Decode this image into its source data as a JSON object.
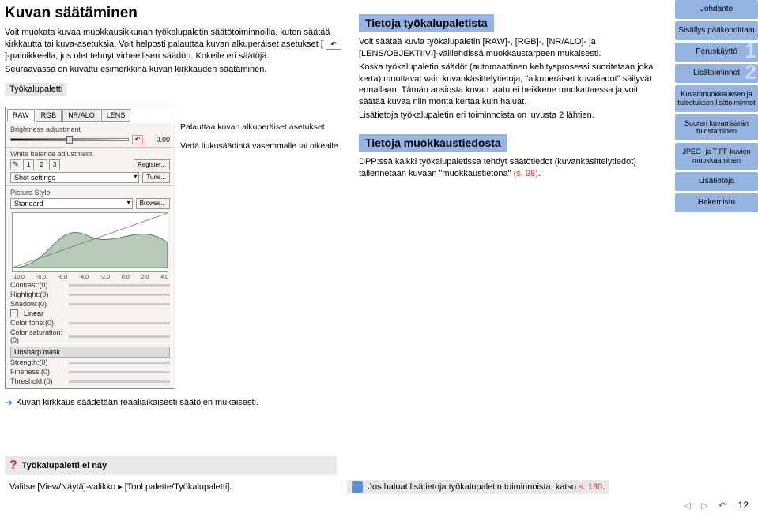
{
  "title": "Kuvan säätäminen",
  "intro": {
    "p1": "Voit muokata kuvaa muokkausikkunan työkalupaletin säätötoiminnoilla, kuten säätää kirkkautta tai kuva-asetuksia. Voit helposti palauttaa kuvan alkuperäiset asetukset [",
    "p1b": "]-painikkeella, jos olet tehnyt virheellisen säädön. Kokeile eri säätöjä.",
    "p2": "Seuraavassa on kuvattu esimerkkinä kuvan kirkkauden säätäminen."
  },
  "palette_label": "Työkalupaletti",
  "callouts": {
    "c1": "Palauttaa kuvan alkuperäiset asetukset",
    "c2": "Vedä liukusäädintä vasemmalle tai oikealle"
  },
  "palette": {
    "tabs": [
      "RAW",
      "RGB",
      "NR/ALO",
      "LENS"
    ],
    "brightness_label": "Brightness adjustment",
    "brightness_val": "0.00",
    "wb_label": "White balance adjustment",
    "wb_btns": [
      "1",
      "2",
      "3"
    ],
    "register": "Register...",
    "shot": "Shot settings",
    "tune": "Tune...",
    "ps_label": "Picture Style",
    "ps_val": "Standard",
    "browse": "Browse...",
    "scale": [
      "-10.0",
      "-8.0",
      "-6.0",
      "-4.0",
      "-2.0",
      "0.0",
      "2.0",
      "4.0"
    ],
    "contrast": "Contrast:(0)",
    "highlight": "Highlight:(0)",
    "shadow": "Shadow:(0)",
    "linear": "Linear",
    "colortone": "Color tone:(0)",
    "colorsat": "Color saturation:(0)",
    "unsharp": "Unsharp mask",
    "strength": "Strength:(0)",
    "fineness": "Fineness:(0)",
    "threshold": "Threshold:(0)"
  },
  "right": {
    "h1": "Tietoja työkalupaletista",
    "p1": "Voit säätää kuvia työkalupaletin [RAW]-, [RGB]-, [NR/ALO]- ja [LENS/OBJEKTIIVI]-välilehdissä muokkaustarpeen mukaisesti.",
    "p2": "Koska työkalupaletin säädöt (automaattinen kehitysprosessi suoritetaan joka kerta) muuttavat vain kuvankäsittelytietoja, \"alkuperäiset kuvatiedot\" säilyvät ennallaan. Tämän ansiosta kuvan laatu ei heikkene muokattaessa ja voit säätää kuvaa niin monta kertaa kuin haluat.",
    "p3": "Lisätietoja työkalupaletin eri toiminnoista on luvusta 2 lähtien.",
    "h2": "Tietoja muokkaustiedosta",
    "p4a": "DPP:ssä kaikki työkalupaletissa tehdyt säätötiedot (kuvankäsittelytiedot) tallennetaan kuvaan \"muokkaustietona\" ",
    "p4link": "(s. 98)",
    "p4b": "."
  },
  "note": "Kuvan kirkkaus säädetään reaaliaikaisesti säätöjen mukaisesti.",
  "faq": {
    "title": "Työkalupaletti ei näy",
    "body": "Valitse [View/Näytä]-valikko ▸ [Tool palette/Työkalupaletti]."
  },
  "hint_a": "Jos haluat lisätietoja työkalupaletin toiminnoista, katso ",
  "hint_link": "s. 130",
  "hint_b": ".",
  "sidebar": {
    "items": [
      {
        "label": "Johdanto"
      },
      {
        "label": "Sisällys pääkohdittain"
      },
      {
        "label": "Peruskäyttö",
        "num": "1"
      },
      {
        "label": "Lisätoiminnot",
        "num": "2"
      },
      {
        "label": "Kuvanmuokkauksen ja tulostuksen lisätoiminnot"
      },
      {
        "label": "Suuren kuvamäärän tulostaminen"
      },
      {
        "label": "JPEG- ja TIFF-kuvien muokkaaminen"
      },
      {
        "label": "Lisätietoja"
      },
      {
        "label": "Hakemisto"
      }
    ]
  },
  "pagenum": "12"
}
